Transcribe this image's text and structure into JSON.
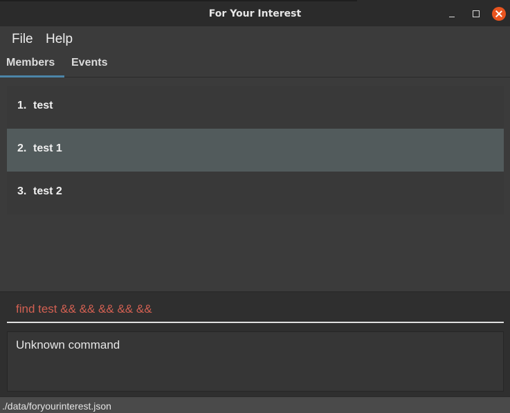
{
  "window": {
    "title": "For Your Interest"
  },
  "menu": {
    "items": [
      "File",
      "Help"
    ]
  },
  "tabs": [
    {
      "label": "Members",
      "selected": true
    },
    {
      "label": "Events",
      "selected": false
    }
  ],
  "members": [
    {
      "index": "1.",
      "name": "test",
      "selected": false
    },
    {
      "index": "2.",
      "name": "test 1",
      "selected": true
    },
    {
      "index": "3.",
      "name": "test 2",
      "selected": false
    }
  ],
  "command": {
    "value": "find test && && && && &&"
  },
  "result": {
    "text": "Unknown command"
  },
  "status": {
    "path": "./data/foryourinterest.json"
  },
  "colors": {
    "accent": "#4c86a9",
    "selected_row": "#525b5c",
    "command_text": "#d26052",
    "close_button": "#e9541f"
  }
}
